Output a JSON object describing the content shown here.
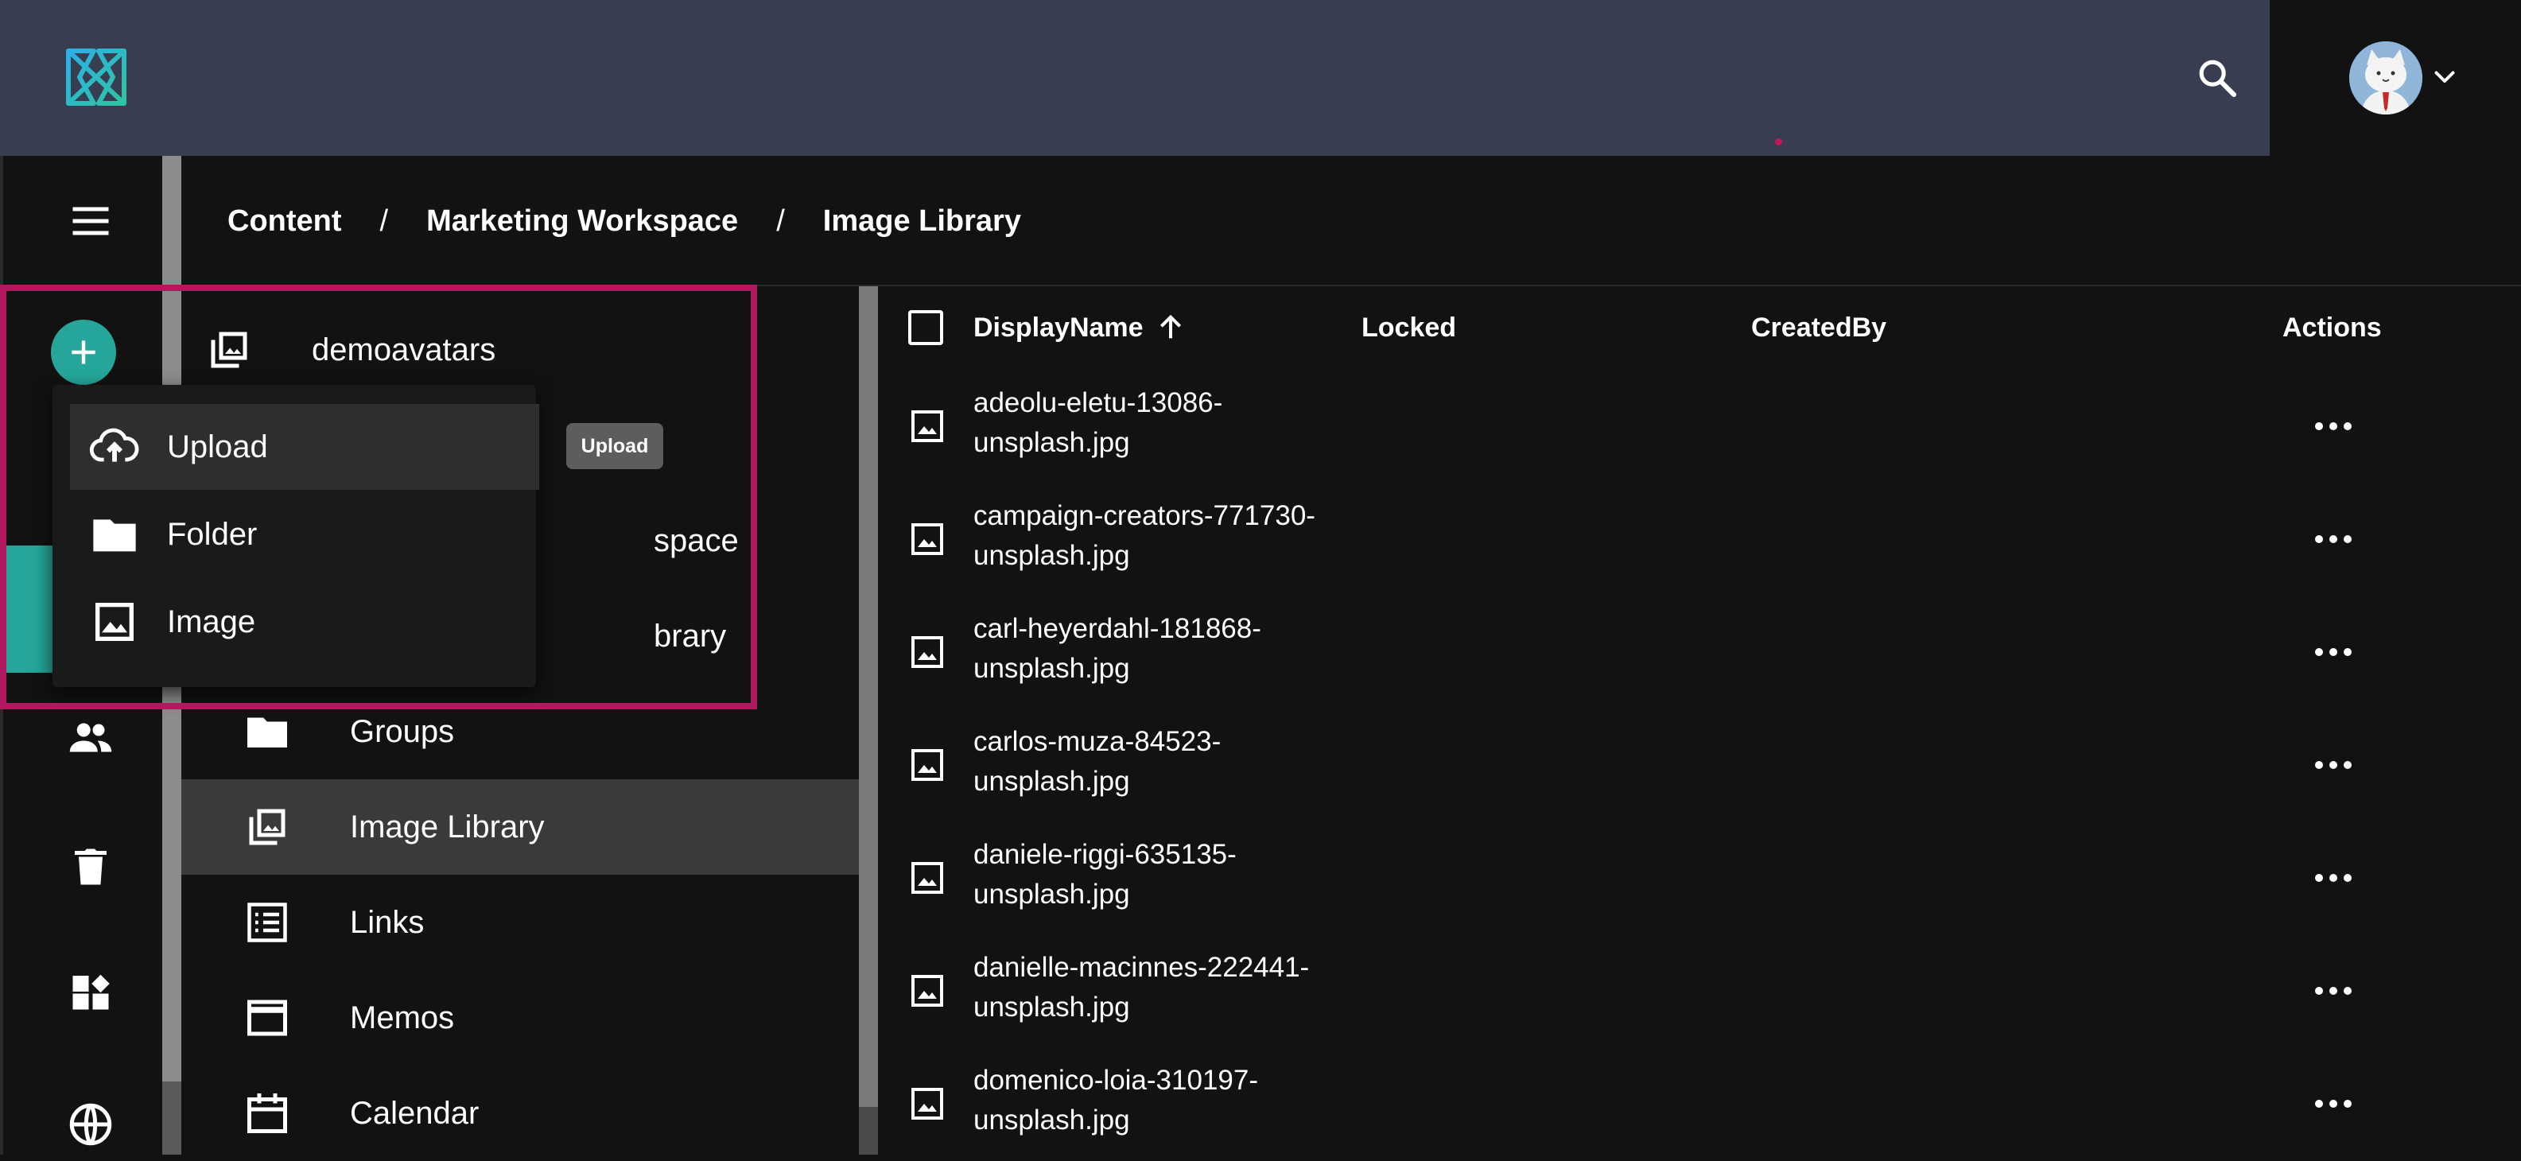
{
  "header": {
    "logo_icon": "brand-logo-icon",
    "search_icon": "search-icon",
    "avatar_icon": "cat-avatar-icon",
    "menu_chevron_icon": "chevron-down-icon"
  },
  "rail": {
    "items": [
      {
        "icon": "hamburger-menu-icon"
      },
      {
        "icon": "add-icon"
      },
      {
        "icon": "people-icon"
      },
      {
        "icon": "trash-icon"
      },
      {
        "icon": "widgets-icon"
      },
      {
        "icon": "globe-icon"
      }
    ],
    "accent_color": "#26a69a"
  },
  "breadcrumb": {
    "items": [
      "Content",
      "Marketing Workspace",
      "Image Library"
    ],
    "separator": "/"
  },
  "tree": {
    "items": [
      {
        "label": "demoavatars",
        "icon": "image-library-icon"
      },
      {
        "label": "space",
        "icon": ""
      },
      {
        "label": "brary",
        "icon": ""
      },
      {
        "label": "Groups",
        "icon": "folder-icon"
      },
      {
        "label": "Image Library",
        "icon": "image-library-icon",
        "selected": true
      },
      {
        "label": "Links",
        "icon": "list-icon"
      },
      {
        "label": "Memos",
        "icon": "window-icon"
      },
      {
        "label": "Calendar",
        "icon": "calendar-icon"
      }
    ]
  },
  "table": {
    "columns": [
      "DisplayName",
      "Locked",
      "CreatedBy",
      "Actions"
    ],
    "sort_icon": "arrow-up-icon",
    "rows": [
      {
        "line1": "adeolu-eletu-13086-",
        "line2": "unsplash.jpg"
      },
      {
        "line1": "campaign-creators-771730-",
        "line2": "unsplash.jpg"
      },
      {
        "line1": "carl-heyerdahl-181868-",
        "line2": "unsplash.jpg"
      },
      {
        "line1": "carlos-muza-84523-",
        "line2": "unsplash.jpg"
      },
      {
        "line1": "daniele-riggi-635135-",
        "line2": "unsplash.jpg"
      },
      {
        "line1": "danielle-macinnes-222441-",
        "line2": "unsplash.jpg"
      },
      {
        "line1": "domenico-loia-310197-",
        "line2": "unsplash.jpg"
      }
    ]
  },
  "menu": {
    "items": [
      {
        "label": "Upload",
        "icon": "cloud-upload-icon"
      },
      {
        "label": "Folder",
        "icon": "folder-icon"
      },
      {
        "label": "Image",
        "icon": "image-icon"
      }
    ],
    "tooltip": "Upload"
  },
  "highlight_color": "#b0195f"
}
